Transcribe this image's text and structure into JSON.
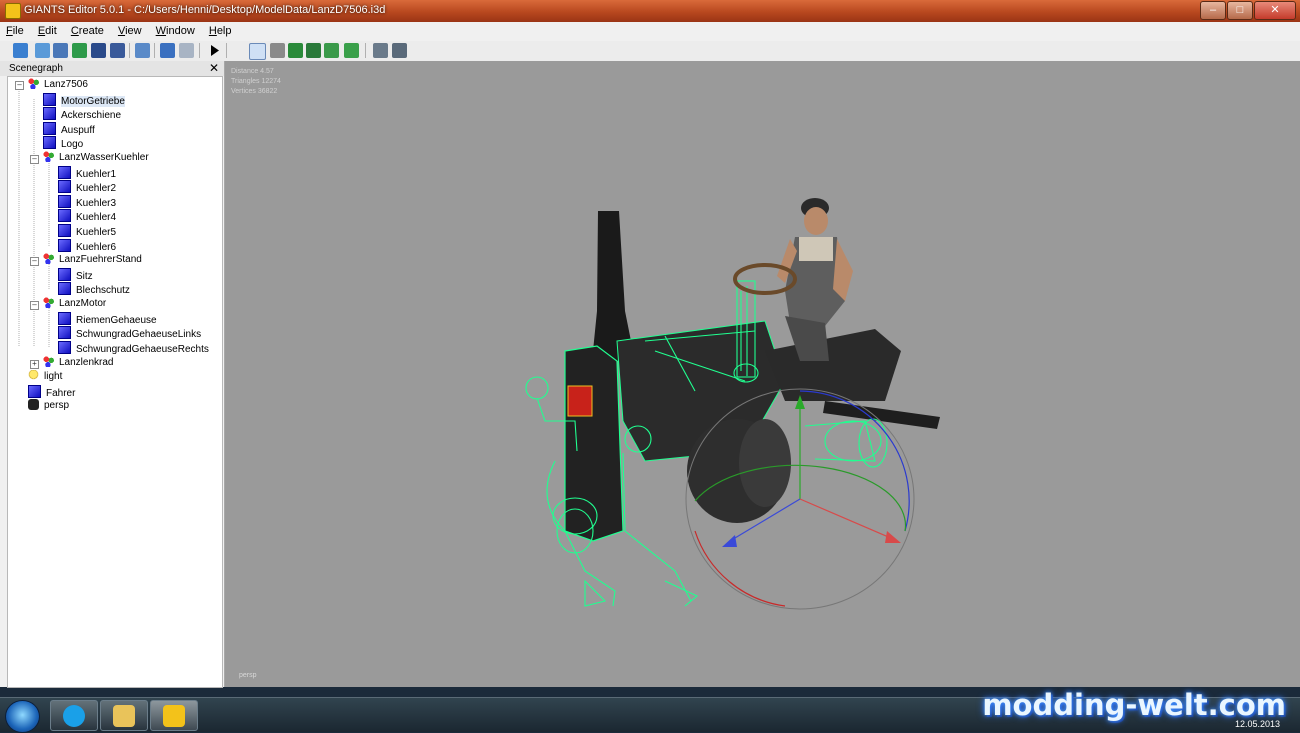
{
  "window": {
    "title": "GIANTS Editor 5.0.1 - C:/Users/Henni/Desktop/ModelData/LanzD7506.i3d",
    "minimize": "–",
    "maximize": "□",
    "close": "✕"
  },
  "menu": [
    "File",
    "Edit",
    "Create",
    "View",
    "Window",
    "Help"
  ],
  "panel": {
    "title": "Scenegraph",
    "close": "✕"
  },
  "tree": [
    {
      "label": "Lanz7506",
      "icon": "transform-group-icon"
    },
    {
      "label": "MotorGetriebe",
      "icon": "shape-icon",
      "selected": true
    },
    {
      "label": "Ackerschiene",
      "icon": "shape-icon"
    },
    {
      "label": "Auspuff",
      "icon": "shape-icon"
    },
    {
      "label": "Logo",
      "icon": "shape-icon"
    },
    {
      "label": "LanzWasserKuehler",
      "icon": "transform-group-icon"
    },
    {
      "label": "Kuehler1",
      "icon": "shape-icon"
    },
    {
      "label": "Kuehler2",
      "icon": "shape-icon"
    },
    {
      "label": "Kuehler3",
      "icon": "shape-icon"
    },
    {
      "label": "Kuehler4",
      "icon": "shape-icon"
    },
    {
      "label": "Kuehler5",
      "icon": "shape-icon"
    },
    {
      "label": "Kuehler6",
      "icon": "shape-icon"
    },
    {
      "label": "LanzFuehrerStand",
      "icon": "transform-group-icon"
    },
    {
      "label": "Sitz",
      "icon": "shape-icon"
    },
    {
      "label": "Blechschutz",
      "icon": "shape-icon"
    },
    {
      "label": "LanzMotor",
      "icon": "transform-group-icon"
    },
    {
      "label": "RiemenGehaeuse",
      "icon": "shape-icon"
    },
    {
      "label": "SchwungradGehaeuseLinks",
      "icon": "shape-icon"
    },
    {
      "label": "SchwungradGehaeuseRechts",
      "icon": "shape-icon"
    },
    {
      "label": "Lanzlenkrad",
      "icon": "transform-group-icon"
    },
    {
      "label": "light",
      "icon": "light-icon"
    },
    {
      "label": "Fahrer",
      "icon": "shape-icon"
    },
    {
      "label": "persp",
      "icon": "camera-icon"
    }
  ],
  "viewport": {
    "stats": [
      "Distance 4.57",
      "Triangles 12274",
      "Vertices 36822"
    ],
    "camera_label": "persp"
  },
  "taskbar": {
    "apps": [
      "skype-icon",
      "explorer-icon",
      "giants-editor-icon"
    ],
    "date": "12.05.2013"
  },
  "watermark": "modding-welt.com",
  "colors": {
    "viewport_bg": "#9a9a9a",
    "wireframe": "#20ff90",
    "titlebar": "#b8481f"
  }
}
